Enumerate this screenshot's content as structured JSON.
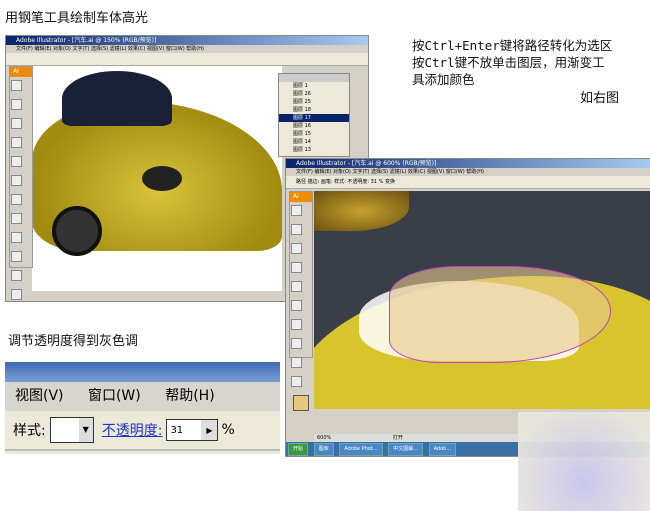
{
  "captions": {
    "title": "用钢笔工具绘制车体高光",
    "step_line1": "按Ctrl+Enter键将路径转化为选区",
    "step_line2": "按Ctrl键不放单击图层，用渐变工",
    "step_line3": "具添加颜色",
    "see_right": "如右图",
    "opacity_note": "调节透明度得到灰色调"
  },
  "window1": {
    "title": "Adobe Illustrator - [汽车.ai @ 150% (RGB/预览)]",
    "menu": "文件(F) 编辑(E) 对象(O) 文字(T) 选择(S) 滤镜(L) 效果(C) 视图(V) 窗口(W) 帮助(H)",
    "app_badge": "Ai",
    "layers": [
      "图层 1",
      "图层 26",
      "图层 25",
      "图层 18",
      "图层 17",
      "图层 16",
      "图层 15",
      "图层 14",
      "图层 13"
    ]
  },
  "window2": {
    "title": "Adobe Illustrator - [汽车.ai @ 600% (RGB/预览)]",
    "menu": "文件(F) 编辑(E) 对象(O) 文字(T) 选择(S) 滤镜(L) 效果(C) 视图(V) 窗口(W) 帮助(H)",
    "options": "路径   描边:   画笔:   样式:   不透明度: 31 %   变换",
    "app_badge": "Ai",
    "zoom": "600%",
    "status": "打开",
    "taskbar": [
      "开始",
      "图库",
      "Adobe Phot...",
      "中文图解...",
      "Adob..."
    ]
  },
  "zoomed_toolbar": {
    "menu_view": "视图(V)",
    "menu_window": "窗口(W)",
    "menu_help": "帮助(H)",
    "style_label": "样式:",
    "opacity_label": "不透明度:",
    "opacity_value": "31",
    "percent": "%"
  }
}
